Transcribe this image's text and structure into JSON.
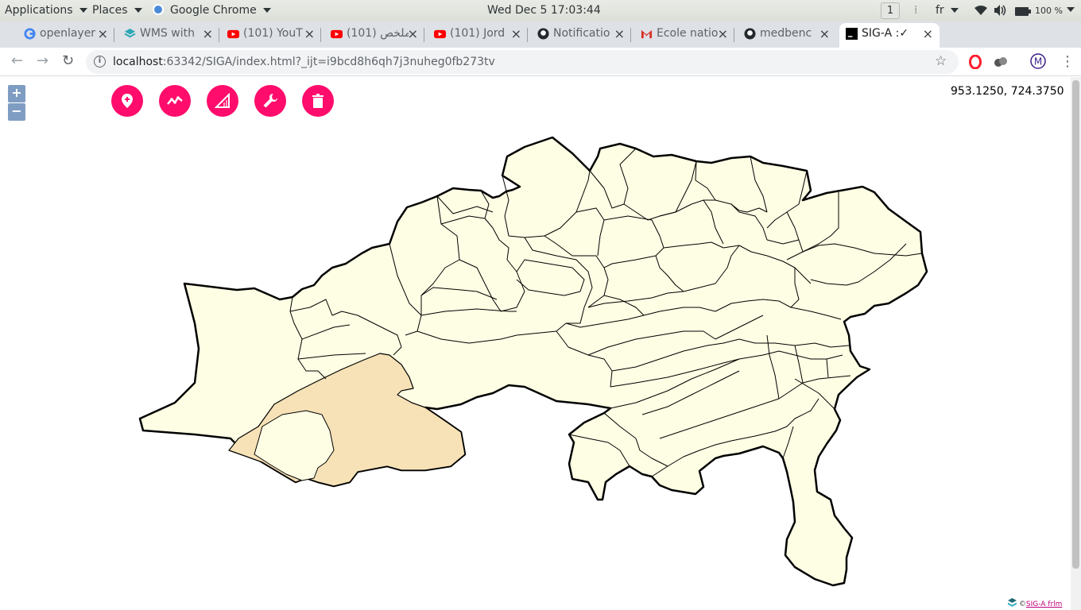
{
  "topbar": {
    "applications": "Applications",
    "places": "Places",
    "app_name": "Google Chrome",
    "datetime": "Wed Dec 5  17:03:44",
    "workspace": "1",
    "language": "fr",
    "battery": "100 %"
  },
  "tabs": [
    {
      "label": "openlayer",
      "icon": "google-icon"
    },
    {
      "label": "WMS with",
      "icon": "layers-icon"
    },
    {
      "label": "(101) YouT",
      "icon": "youtube-icon"
    },
    {
      "label": "ملخص (101)",
      "icon": "youtube-icon"
    },
    {
      "label": "(101) Jord",
      "icon": "youtube-icon"
    },
    {
      "label": "Notificatio",
      "icon": "github-icon"
    },
    {
      "label": "Ecole natio",
      "icon": "gmail-icon"
    },
    {
      "label": "medbenc",
      "icon": "github-icon"
    },
    {
      "label": "SIG-A :✓",
      "icon": "webstorm-icon",
      "active": true
    }
  ],
  "toolbar": {
    "url_host": "localhost",
    "url_rest": ":63342/SIGA/index.html?_ijt=i9bcd8h6qh7j3nuheg0fb273tv"
  },
  "map": {
    "coords": "953.1250, 724.3750",
    "zoom_in": "+",
    "zoom_out": "−",
    "tools": [
      "add-point",
      "draw-line",
      "measure-area",
      "settings",
      "delete"
    ],
    "attribution_prefix": "©",
    "attribution_link": "SIG-A frlm",
    "colors": {
      "region_fill": "#fefee4",
      "highlight_fill": "#f7e2b7",
      "tool_button": "#ff0c6c"
    }
  }
}
